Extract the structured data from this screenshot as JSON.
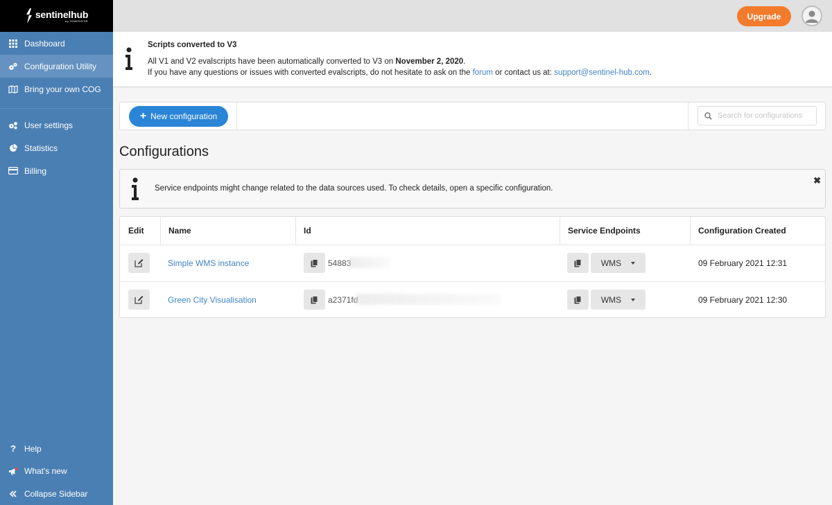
{
  "brand": {
    "name": "sentinelhub",
    "sub": "by SINERGISE"
  },
  "sidebar": {
    "items": [
      {
        "label": "Dashboard",
        "icon": "grid-icon"
      },
      {
        "label": "Configuration Utility",
        "icon": "cogs-icon"
      },
      {
        "label": "Bring your own COG",
        "icon": "map-icon"
      },
      {
        "label": "User settings",
        "icon": "user-cogs-icon"
      },
      {
        "label": "Statistics",
        "icon": "pie-chart-icon"
      },
      {
        "label": "Billing",
        "icon": "credit-card-icon"
      }
    ],
    "bottom": [
      {
        "label": "Help",
        "icon": "question-icon"
      },
      {
        "label": "What's new",
        "icon": "megaphone-icon"
      },
      {
        "label": "Collapse Sidebar",
        "icon": "double-chevron-left-icon"
      }
    ]
  },
  "header": {
    "upgrade_label": "Upgrade"
  },
  "announcement": {
    "title": "Scripts converted to V3",
    "line1_prefix": "All V1 and V2 evalscripts have been automatically converted to V3 on ",
    "line1_bold": "November 2, 2020",
    "line1_suffix": ".",
    "line2_prefix": "If you have any questions or issues with converted evalscripts, do not hesitate to ask on the ",
    "line2_link": "forum",
    "line2_mid": " or contact us at: ",
    "line2_email": "support@sentinel-hub.com",
    "line2_suffix": "."
  },
  "toolbar": {
    "new_label": "New configuration",
    "search_placeholder": "Search for configurations"
  },
  "page_title": "Configurations",
  "info": {
    "text": "Service endpoints might change related to the data sources used. To check details, open a specific configuration."
  },
  "table": {
    "headers": {
      "edit": "Edit",
      "name": "Name",
      "id": "Id",
      "endpoints": "Service Endpoints",
      "created": "Configuration Created"
    },
    "rows": [
      {
        "name": "Simple WMS instance",
        "id": "54883",
        "endpoint": "WMS",
        "created": "09 February 2021 12:31"
      },
      {
        "name": "Green City Visualisation",
        "id": "a2371fd",
        "endpoint": "WMS",
        "created": "09 February 2021 12:30"
      }
    ]
  },
  "colors": {
    "sidebar": "#4a7fb3",
    "sidebar_active": "#6592c0",
    "accent": "#2b85d6",
    "upgrade": "#f27b2c",
    "link": "#3f85c8"
  }
}
